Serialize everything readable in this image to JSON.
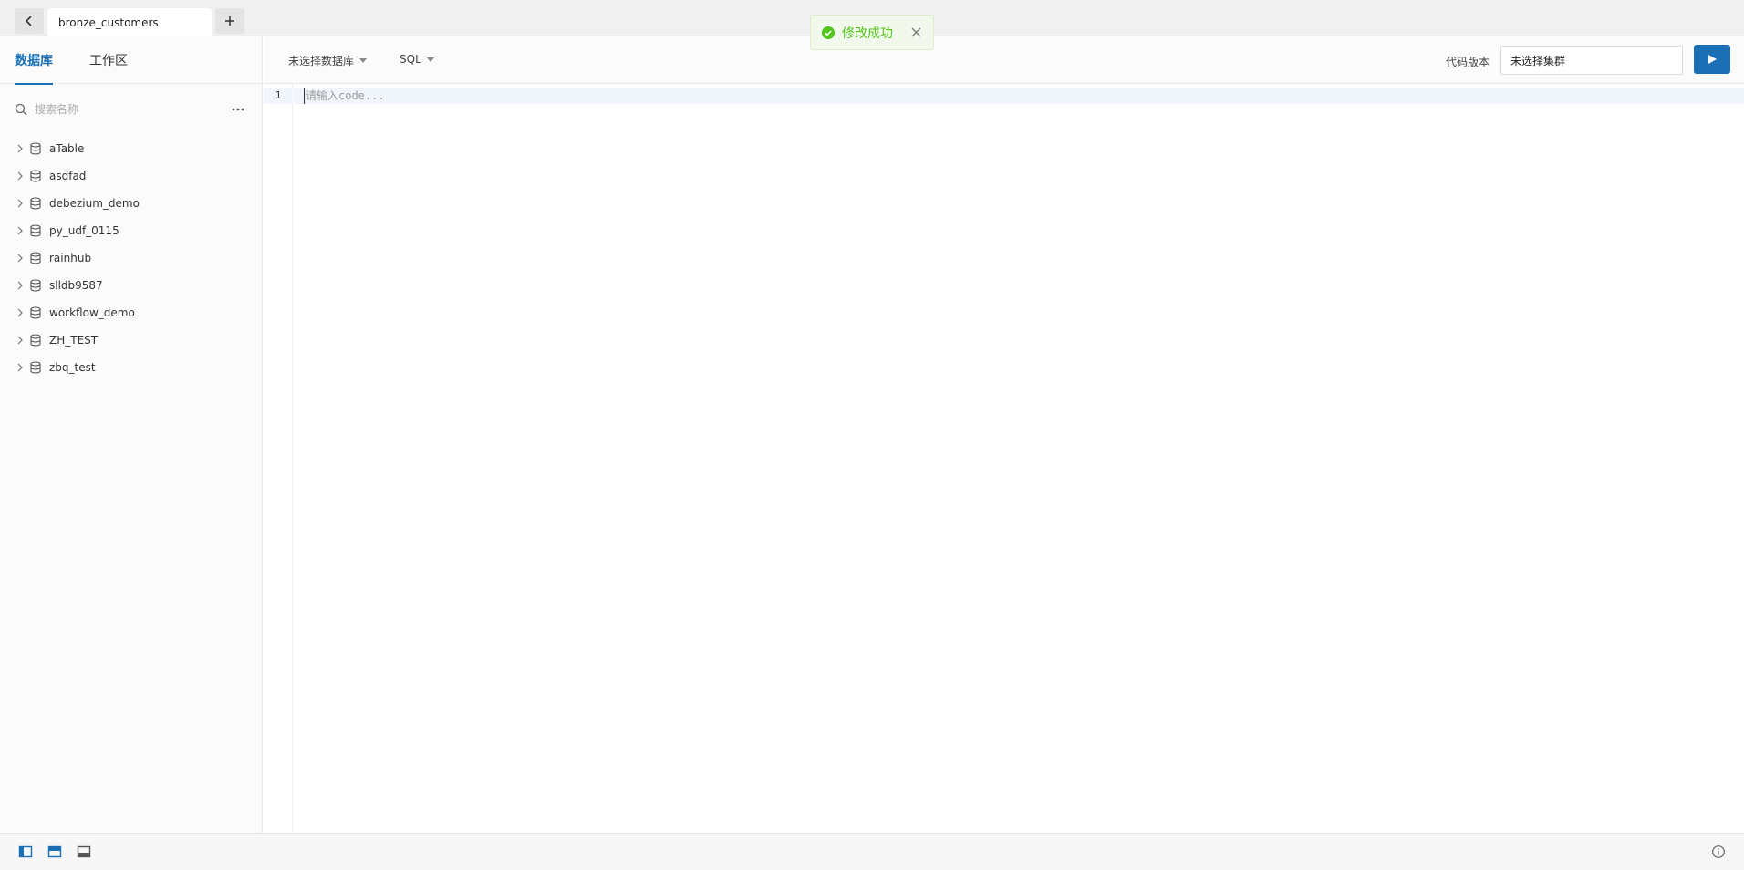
{
  "tabbar": {
    "active_tab": "bronze_customers"
  },
  "toast": {
    "message": "修改成功"
  },
  "sidebar": {
    "tabs": [
      {
        "label": "数据库",
        "active": true
      },
      {
        "label": "工作区",
        "active": false
      }
    ],
    "search": {
      "placeholder": "搜索名称"
    },
    "databases": [
      "aTable",
      "asdfad",
      "debezium_demo",
      "py_udf_0115",
      "rainhub",
      "slldb9587",
      "workflow_demo",
      "ZH_TEST",
      "zbq_test"
    ]
  },
  "toolbar": {
    "database_select": "未选择数据库",
    "language_select": "SQL",
    "version_label": "代码版本",
    "cluster_select": "未选择集群"
  },
  "editor": {
    "line_number": "1",
    "placeholder": "请输入code..."
  },
  "colors": {
    "accent": "#1a6fb5",
    "success": "#52c41a"
  }
}
